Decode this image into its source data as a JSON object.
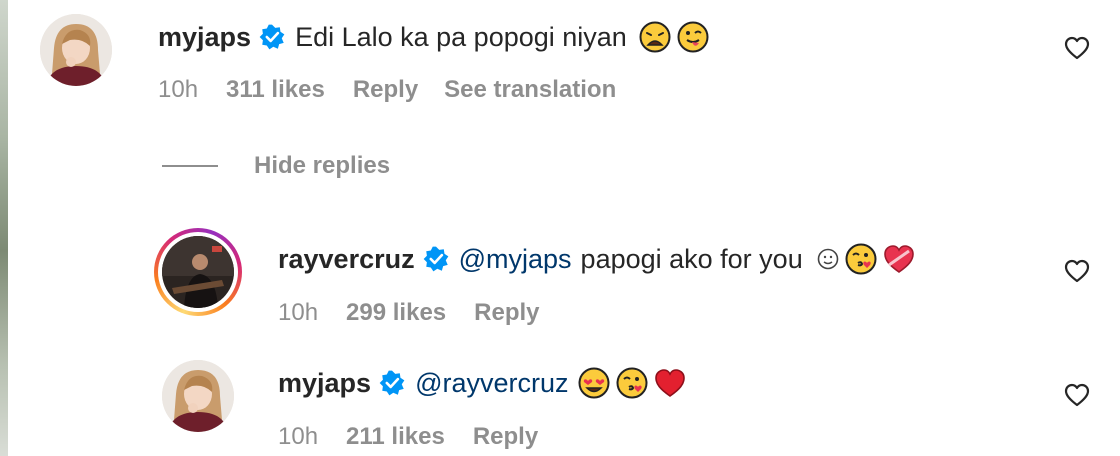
{
  "comment": {
    "username": "myjaps",
    "text": "Edi Lalo ka pa popogi niyan",
    "emojis": [
      "weary-face",
      "winking-tongue-face"
    ],
    "time": "10h",
    "likes": "311 likes",
    "reply_label": "Reply",
    "translate_label": "See translation"
  },
  "hide_replies_label": "Hide replies",
  "replies": [
    {
      "username": "rayvercruz",
      "mention": "@myjaps",
      "text": "papogi ako for you",
      "emojis": [
        "slight-smile-face",
        "face-blowing-kiss",
        "heart-with-ribbon"
      ],
      "time": "10h",
      "likes": "299 likes",
      "reply_label": "Reply",
      "has_story_ring": true
    },
    {
      "username": "myjaps",
      "mention": "@rayvercruz",
      "text": "",
      "emojis": [
        "heart-eyes-face",
        "face-blowing-kiss",
        "red-heart"
      ],
      "time": "10h",
      "likes": "211 likes",
      "reply_label": "Reply",
      "has_story_ring": false
    }
  ],
  "colors": {
    "text": "#262626",
    "meta": "#8e8e8e",
    "mention": "#00376b",
    "verified": "#0095f6"
  }
}
